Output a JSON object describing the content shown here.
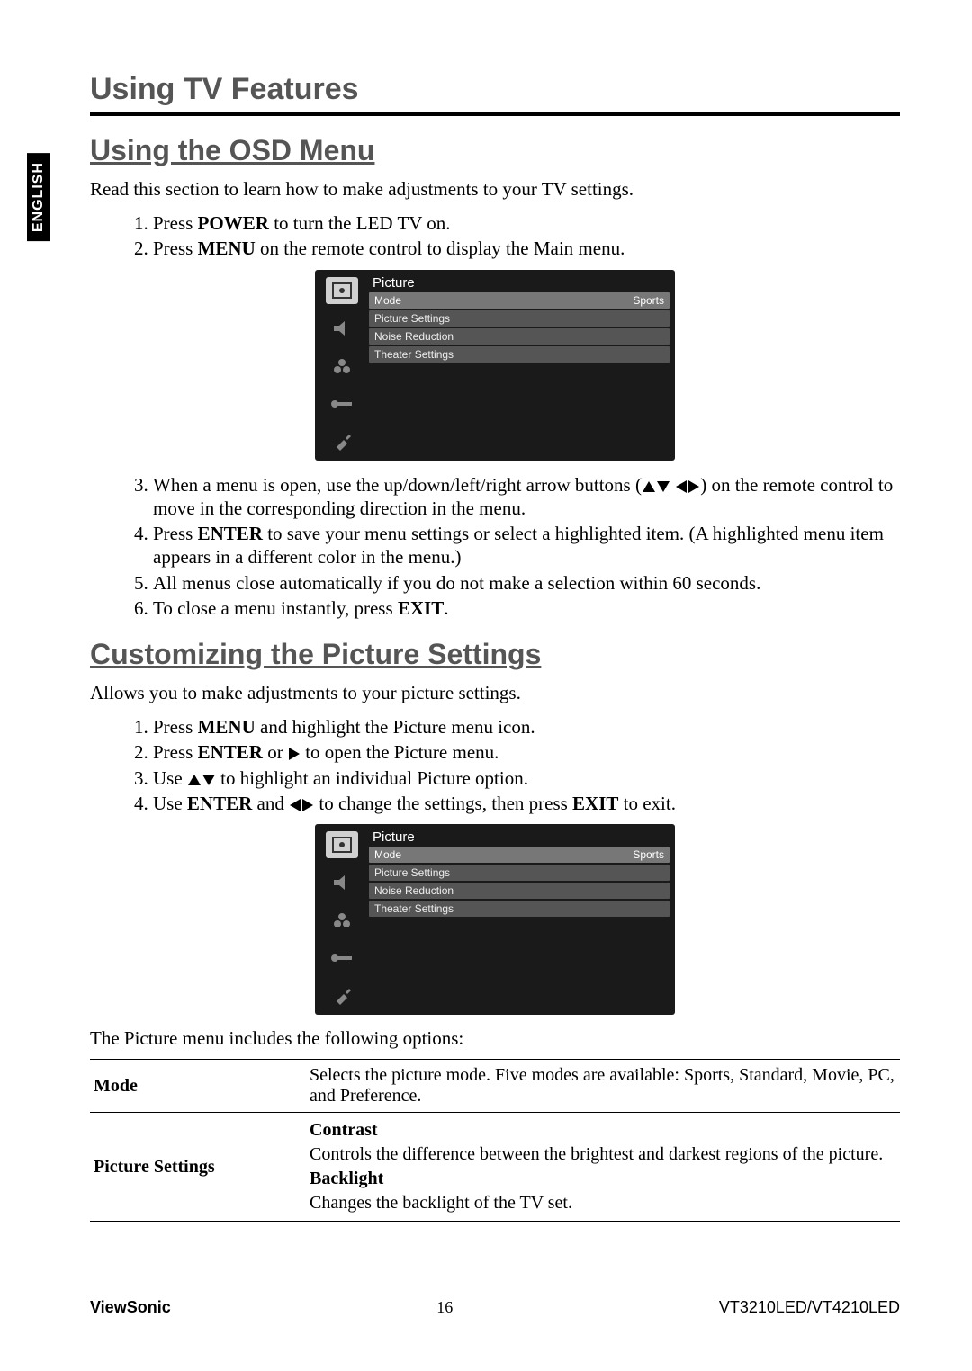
{
  "lang_tab": "ENGLISH",
  "page_title": "Using TV Features",
  "section1": {
    "heading": "Using the OSD Menu",
    "intro": "Read this section to learn how to make adjustments to your TV settings.",
    "steps": {
      "s1_a": "Press ",
      "s1_b": "POWER",
      "s1_c": " to turn the LED TV on.",
      "s2_a": "Press ",
      "s2_b": "MENU",
      "s2_c": " on the remote control to display the Main menu.",
      "s3_a": "When a menu is open, use the up/down/left/right arrow buttons (",
      "s3_b": ") on the remote control to move in the corresponding direction in the menu.",
      "s4_a": "Press ",
      "s4_b": "ENTER",
      "s4_c": " to save your menu settings or select a highlighted item. (A highlighted menu item appears in a different color in the menu.)",
      "s5": "All menus close automatically if you do not make a selection within 60 seconds.",
      "s6_a": "To close a menu instantly, press ",
      "s6_b": "EXIT",
      "s6_c": "."
    }
  },
  "section2": {
    "heading": "Customizing the Picture Settings",
    "intro": "Allows you to make adjustments to your picture settings.",
    "steps": {
      "s1_a": "Press ",
      "s1_b": "MENU",
      "s1_c": " and highlight the Picture menu icon.",
      "s2_a": "Press ",
      "s2_b": "ENTER",
      "s2_c": " or ",
      "s2_d": " to open the Picture menu.",
      "s3_a": "Use ",
      "s3_b": " to highlight an individual Picture option.",
      "s4_a": "Use ",
      "s4_b": "ENTER",
      "s4_c": " and ",
      "s4_d": " to change the settings, then press ",
      "s4_e": "EXIT",
      "s4_f": " to exit."
    }
  },
  "osd": {
    "title": "Picture",
    "rows": [
      {
        "label": "Mode",
        "value": "Sports"
      },
      {
        "label": "Picture Settings",
        "value": ""
      },
      {
        "label": "Noise Reduction",
        "value": ""
      },
      {
        "label": "Theater Settings",
        "value": ""
      }
    ]
  },
  "options_intro": "The Picture menu includes the following options:",
  "options": {
    "mode_label": "Mode",
    "mode_desc": "Selects the picture mode. Five modes are available: Sports, Standard, Movie, PC, and Preference.",
    "ps_label": "Picture Settings",
    "contrast_h": "Contrast",
    "contrast_d": "Controls the difference between the brightest and darkest regions of the picture.",
    "backlight_h": "Backlight",
    "backlight_d": "Changes the backlight of the TV set."
  },
  "footer": {
    "brand": "ViewSonic",
    "page": "16",
    "model": "VT3210LED/VT4210LED"
  }
}
